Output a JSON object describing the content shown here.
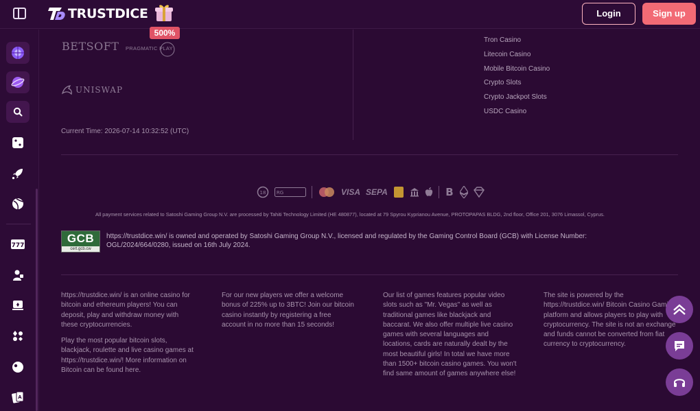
{
  "header": {
    "logo_text": "TRUSTDICE",
    "bonus_badge": "500%",
    "login_label": "Login",
    "signup_label": "Sign up"
  },
  "sidebar": {
    "icons": [
      "globe-spin-icon",
      "planet-icon",
      "search-icon",
      "dice-icon",
      "rocket-icon",
      "sports-ball-icon",
      "slot-777-icon",
      "live-dealer-icon",
      "card-table-icon",
      "poker-chips-icon",
      "roulette-icon",
      "playing-cards-icon"
    ]
  },
  "providers": {
    "betsoft": "BETSOFT",
    "pragmatic": "PRAGMATIC PLAY",
    "uniswap": "UNISWAP"
  },
  "current_time": "Current Time: 2026-07-14 10:32:52 (UTC)",
  "links": [
    "Tron Casino",
    "Litecoin Casino",
    "Mobile Bitcoin Casino",
    "Crypto Slots",
    "Crypto Jackpot Slots",
    "USDC Casino"
  ],
  "payments": {
    "visa": "VISA",
    "sepa": "SEPA"
  },
  "payment_notice": "All payment services related to Satoshi Gaming Group N.V. are processed by Tahiti Technology Limited (HE 480877), located at 79 Spyrou Kyprianou Avenue, PROTOPAPAS BLDG, 2nd floor, Office 201, 3076 Limassol, Cyprus.",
  "gcb": {
    "title": "GCB",
    "sub": "cert.gcb.cw"
  },
  "license_text": "https://trustdice.win/ is owned and operated by Satoshi Gaming Group N.V., licensed and regulated by the Gaming Control Board (GCB) with License Number: OGL/2024/664/0280, issued on 16th July 2024.",
  "footer": {
    "col1_p1": "https://trustdice.win/ is an online casino for bitcoin and ethereum players! You can deposit, play and withdraw money with these cryptocurrencies.",
    "col1_p2": "Play the most popular bitcoin slots, blackjack, roulette and live casino games at https://trustdice.win/! More information on Bitcoin can be found here.",
    "col2": "For our new players we offer a welcome bonus of 225% up to 3BTC! Join our bitcoin casino instantly by registering a free account in no more than 15 seconds!",
    "col3": "Our list of games features popular video slots such as \"Mr. Vegas\" as well as traditional games like blackjack and baccarat. We also offer multiple live casino games with several languages and locations, cards are naturally dealt by the most beautiful girls! In total we have more than 1500+ bitcoin casino games. You won't find same amount of games anywhere else!",
    "col4": "The site is powered by the https://trustdice.win/ Bitcoin Casino Gaming platform and allows players to play with cryptocurrency. The site is not an exchange and funds cannot be converted from fiat currency to cryptocurrency."
  },
  "floating": [
    "scroll-top-icon",
    "chat-icon",
    "support-headset-icon"
  ],
  "colors": {
    "background": "#2b0a33",
    "signup": "#f26a75",
    "badge": "#e05366",
    "float_button": "#7a3d96"
  }
}
